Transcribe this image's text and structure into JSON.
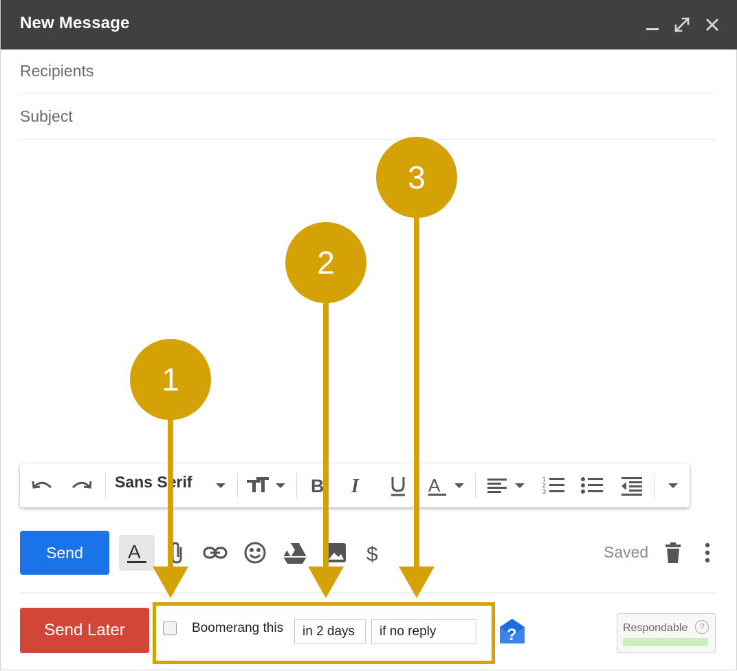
{
  "window": {
    "title": "New Message"
  },
  "fields": {
    "recipients_placeholder": "Recipients",
    "subject_placeholder": "Subject"
  },
  "format_bar": {
    "font_family": "Sans Serif"
  },
  "actions": {
    "send_label": "Send",
    "status": "Saved"
  },
  "boomerang": {
    "send_later_label": "Send Later",
    "checkbox_label": "Boomerang this",
    "checked": false,
    "when_value": "in 2 days",
    "condition_value": "if no reply"
  },
  "respondable": {
    "label": "Respondable",
    "help_symbol": "?"
  },
  "callouts": [
    {
      "number": "1"
    },
    {
      "number": "2"
    },
    {
      "number": "3"
    }
  ],
  "colors": {
    "titlebar": "#404040",
    "send": "#1a73e8",
    "send_later": "#d24638",
    "callout": "#d4a106",
    "respondable_bar": "#c9efc0"
  }
}
